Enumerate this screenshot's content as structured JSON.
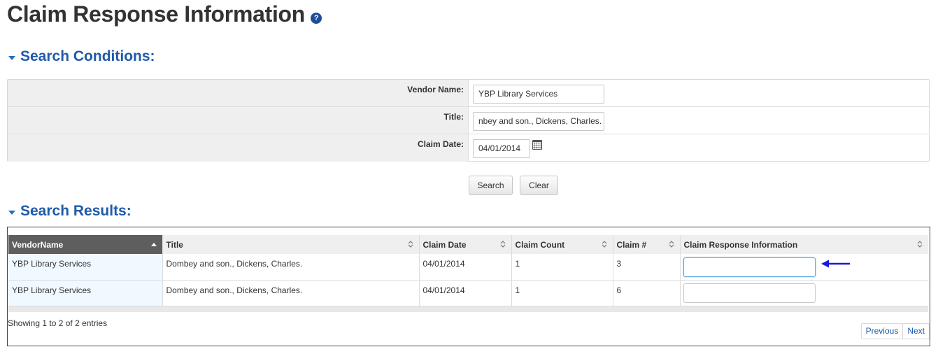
{
  "page": {
    "title": "Claim Response Information",
    "help_icon": "question-icon"
  },
  "search_conditions": {
    "heading": "Search Conditions:",
    "fields": {
      "vendor_name": {
        "label": "Vendor Name:",
        "value": "YBP Library Services"
      },
      "title": {
        "label": "Title:",
        "value": "nbey and son., Dickens, Charles."
      },
      "claim_date": {
        "label": "Claim Date:",
        "value": "04/01/2014"
      }
    },
    "buttons": {
      "search": "Search",
      "clear": "Clear"
    }
  },
  "search_results": {
    "heading": "Search Results:",
    "columns": [
      "VendorName",
      "Title",
      "Claim Date",
      "Claim Count",
      "Claim #",
      "Claim Response Information"
    ],
    "sorted_column": "VendorName",
    "rows": [
      {
        "vendor": "YBP Library Services",
        "title": "Dombey and son., Dickens, Charles.",
        "claim_date": "04/01/2014",
        "claim_count": "1",
        "claim_no": "3",
        "response": ""
      },
      {
        "vendor": "YBP Library Services",
        "title": "Dombey and son., Dickens, Charles.",
        "claim_date": "04/01/2014",
        "claim_count": "1",
        "claim_no": "6",
        "response": ""
      }
    ],
    "info": "Showing 1 to 2 of 2 entries",
    "pager": {
      "previous": "Previous",
      "next": "Next"
    }
  },
  "colors": {
    "heading_blue": "#1f5aab",
    "sorted_header": "#5e5e5e",
    "annotation_arrow": "#1a1adb"
  }
}
